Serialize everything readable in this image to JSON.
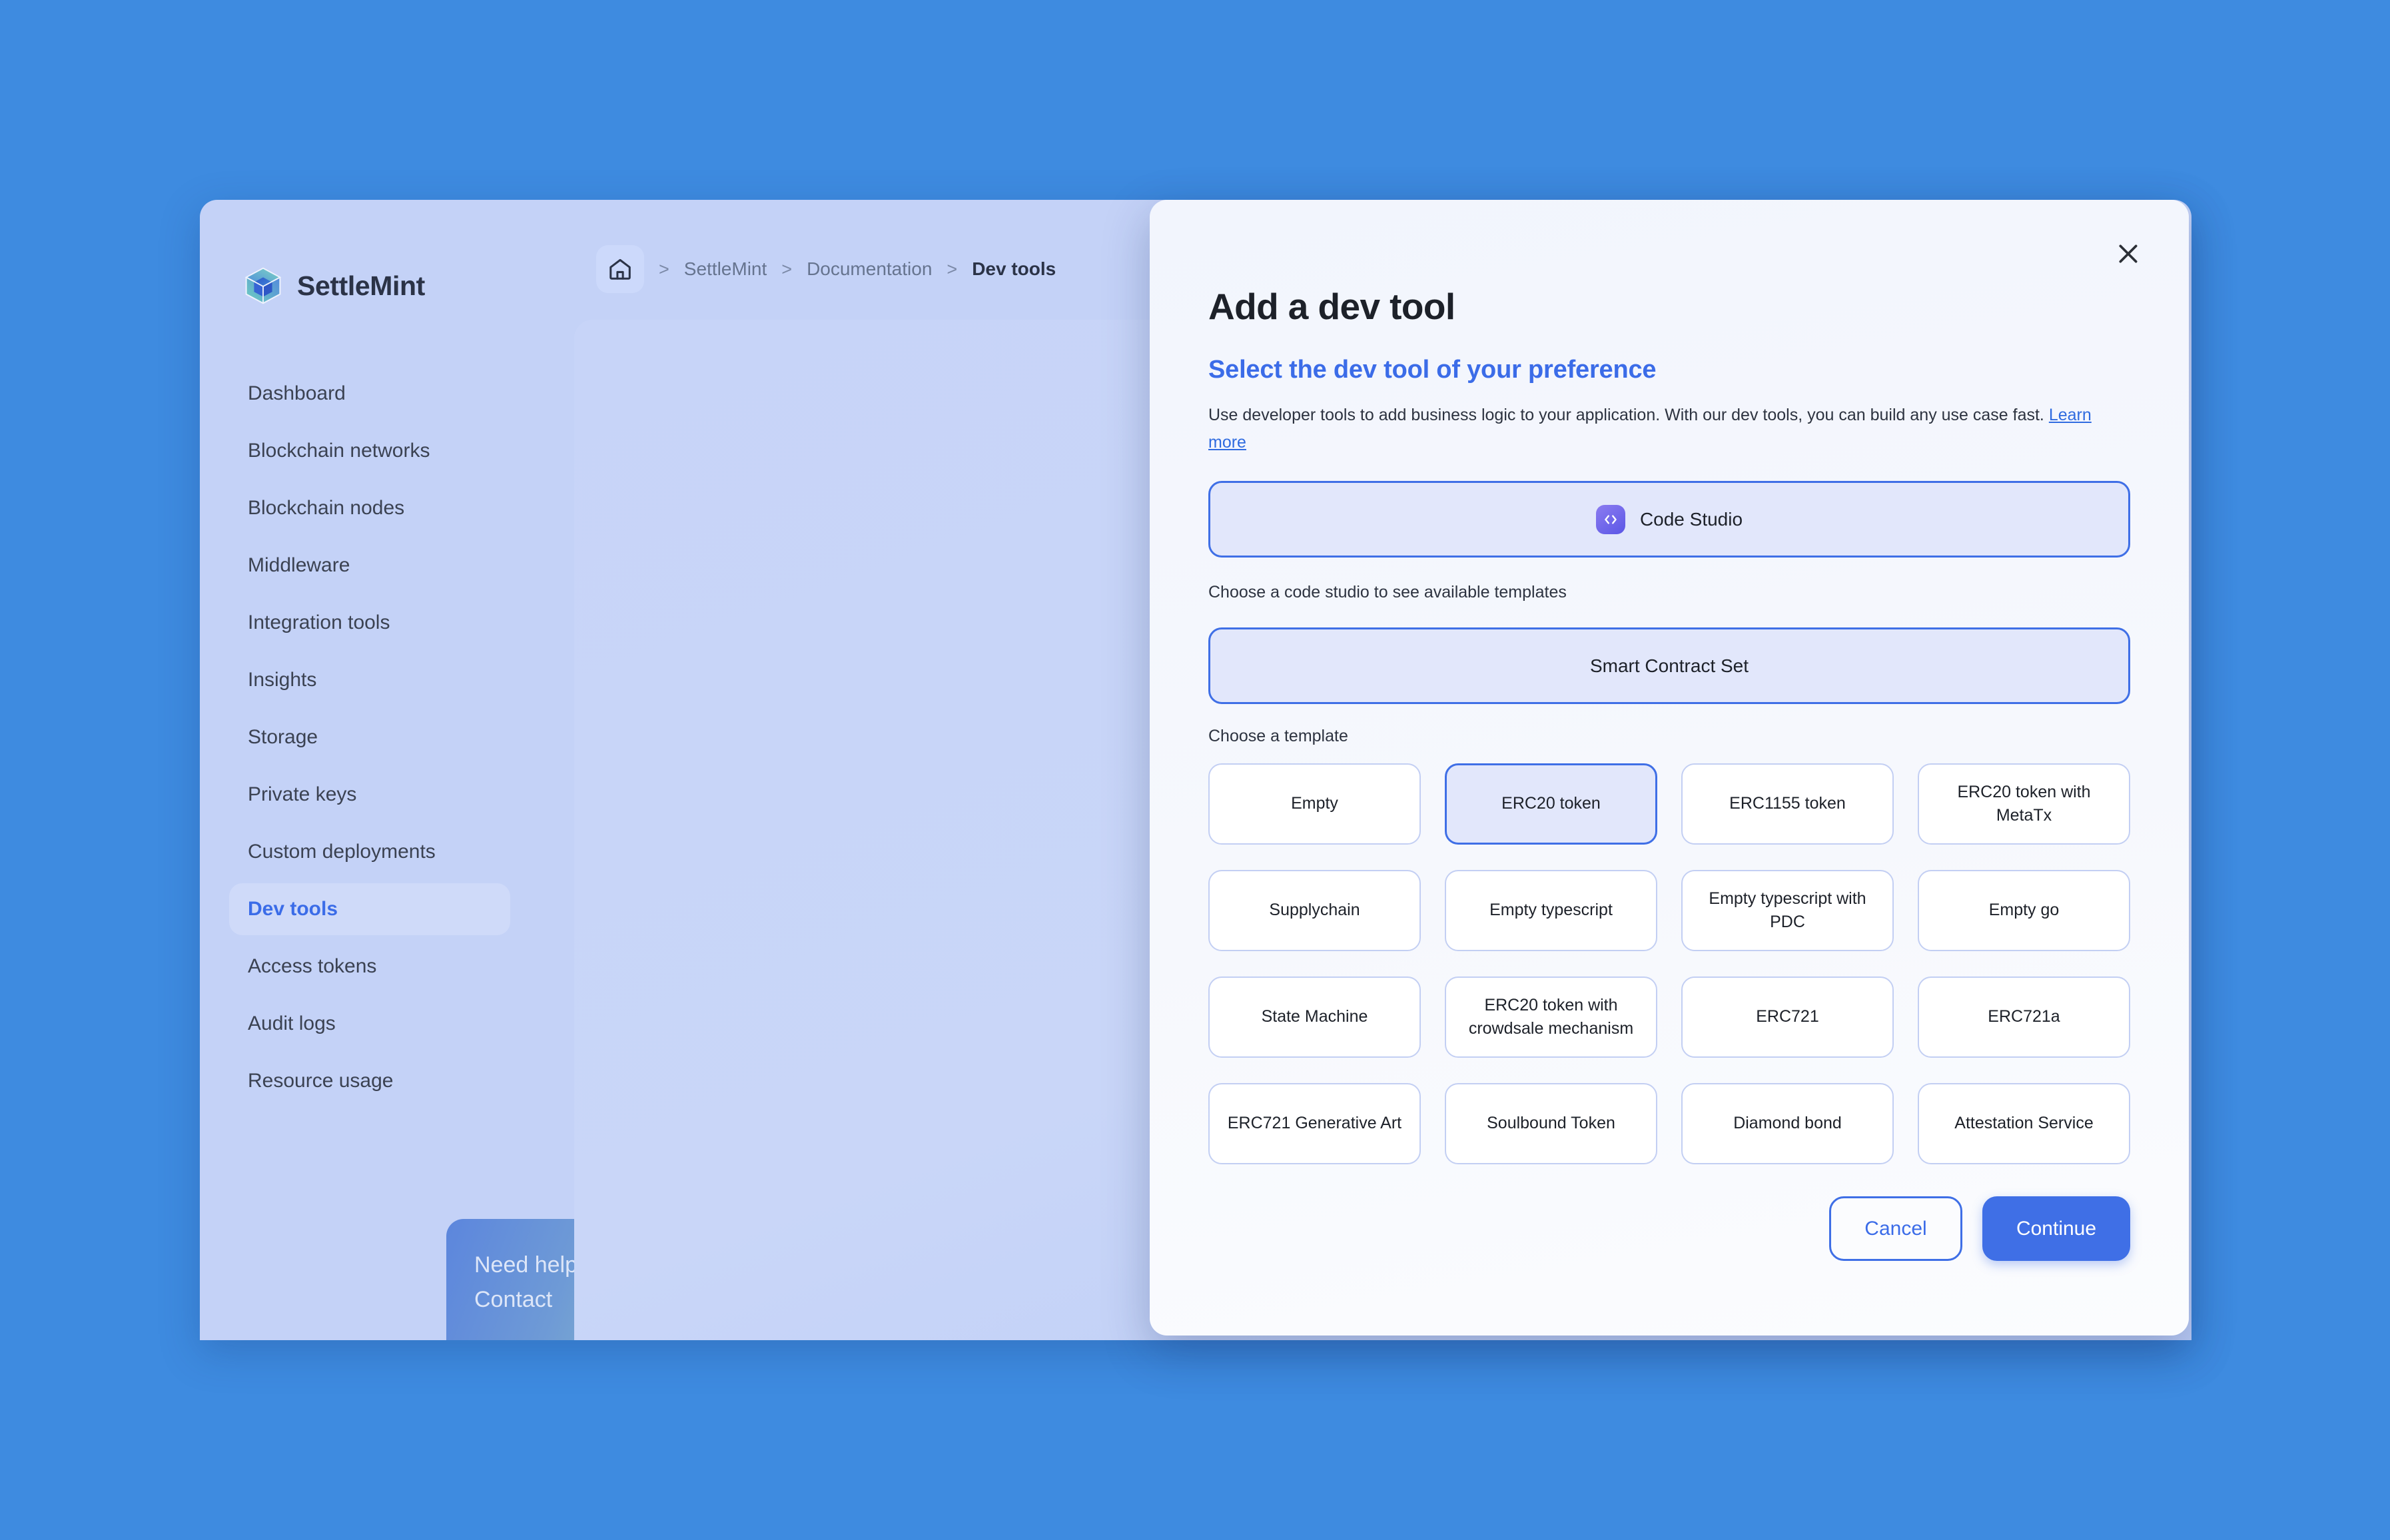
{
  "colors": {
    "page_background": "#3e8be0",
    "app_background": "#c4d2f7",
    "accent": "#3f6fe6",
    "accent_text": "#3b6ce8",
    "selected_fill": "#e2e7fb",
    "text_primary": "#1d2129",
    "text_muted": "#66748f"
  },
  "sidebar": {
    "brand": {
      "name": "SettleMint",
      "logo_icon": "cube-logo-icon"
    },
    "items": [
      {
        "label": "Dashboard",
        "active": false
      },
      {
        "label": "Blockchain networks",
        "active": false
      },
      {
        "label": "Blockchain nodes",
        "active": false
      },
      {
        "label": "Middleware",
        "active": false
      },
      {
        "label": "Integration tools",
        "active": false
      },
      {
        "label": "Insights",
        "active": false
      },
      {
        "label": "Storage",
        "active": false
      },
      {
        "label": "Private keys",
        "active": false
      },
      {
        "label": "Custom deployments",
        "active": false
      },
      {
        "label": "Dev tools",
        "active": true
      },
      {
        "label": "Access tokens",
        "active": false
      },
      {
        "label": "Audit logs",
        "active": false
      },
      {
        "label": "Resource usage",
        "active": false
      }
    ],
    "help_card": {
      "line1": "Need help?",
      "line2": "Contact"
    }
  },
  "breadcrumb": {
    "home_icon": "home-icon",
    "separator": ">",
    "items": [
      {
        "label": "SettleMint",
        "current": false
      },
      {
        "label": "Documentation",
        "current": false
      },
      {
        "label": "Dev tools",
        "current": true
      }
    ]
  },
  "content": {
    "message": "Use developer tools to add busine"
  },
  "modal": {
    "close_icon": "close-icon",
    "title": "Add a dev tool",
    "subtitle": "Select the dev tool of your preference",
    "description": "Use developer tools to add business logic to your application. With our dev tools, you can build any use case fast. ",
    "learn_more_label": "Learn more",
    "dev_tool": {
      "icon": "code-brackets-icon",
      "label": "Code Studio",
      "selected": true
    },
    "code_studio_label": "Choose a code studio to see available templates",
    "code_studio": {
      "label": "Smart Contract Set",
      "selected": true
    },
    "template_label": "Choose a template",
    "templates": [
      {
        "label": "Empty",
        "selected": false
      },
      {
        "label": "ERC20 token",
        "selected": true
      },
      {
        "label": "ERC1155 token",
        "selected": false
      },
      {
        "label": "ERC20 token with MetaTx",
        "selected": false
      },
      {
        "label": "Supplychain",
        "selected": false
      },
      {
        "label": "Empty typescript",
        "selected": false
      },
      {
        "label": "Empty typescript with PDC",
        "selected": false
      },
      {
        "label": "Empty go",
        "selected": false
      },
      {
        "label": "State Machine",
        "selected": false
      },
      {
        "label": "ERC20 token with crowdsale mechanism",
        "selected": false
      },
      {
        "label": "ERC721",
        "selected": false
      },
      {
        "label": "ERC721a",
        "selected": false
      },
      {
        "label": "ERC721 Generative Art",
        "selected": false
      },
      {
        "label": "Soulbound Token",
        "selected": false
      },
      {
        "label": "Diamond bond",
        "selected": false
      },
      {
        "label": "Attestation Service",
        "selected": false
      }
    ],
    "cancel_label": "Cancel",
    "continue_label": "Continue"
  }
}
